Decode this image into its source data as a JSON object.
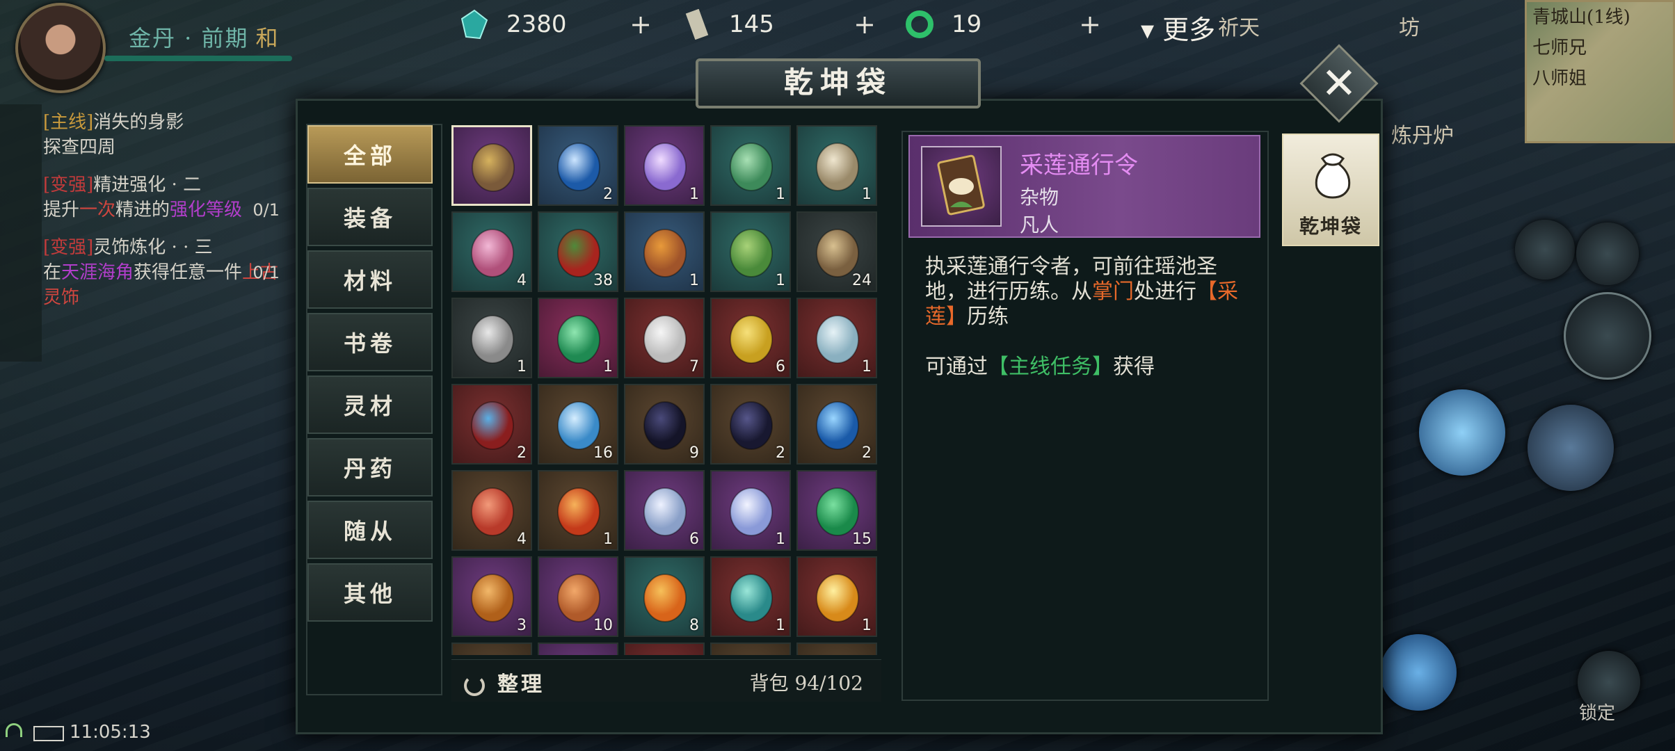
{
  "hud": {
    "realm": "金丹 · 前期",
    "mode": "和",
    "resources": [
      {
        "icon": "jade-gem-icon",
        "value": "2380"
      },
      {
        "icon": "token-ticket-icon",
        "value": "145"
      },
      {
        "icon": "green-jade-ring-icon",
        "value": "19"
      }
    ],
    "more_label": "更多",
    "top_icons": [
      "祈天",
      "坊",
      "炼丹炉"
    ],
    "minimap": {
      "line1": "青城山(1线)",
      "line2": "七师兄",
      "line3": "八师姐"
    }
  },
  "quests": [
    {
      "tag": "[主线]",
      "title": "消失的身影",
      "desc": "探查四周",
      "count": ""
    },
    {
      "tag": "[变强]",
      "title": "精进强化 · 二",
      "desc_pre": "提升",
      "desc_hl1": "一次",
      "desc_mid": "精进的",
      "desc_hl2": "强化等级",
      "count": "0/1"
    },
    {
      "tag": "[变强]",
      "title": "灵饰炼化 · · 三",
      "desc_pre": "在",
      "desc_hl1": "天涯海角",
      "desc_mid": "获得任意一件",
      "desc_hl2": "上古灵饰",
      "count": "0/1"
    }
  ],
  "status": {
    "time": "11:05:13"
  },
  "lock_label": "锁定",
  "window": {
    "title": "乾坤袋",
    "close_label": "✕",
    "categories": [
      "全部",
      "装备",
      "材料",
      "书卷",
      "灵材",
      "丹药",
      "随从",
      "其他"
    ],
    "active_category": "全部",
    "items": [
      {
        "q": "purple",
        "icon": "lotus-token-icon",
        "n": "",
        "c1": "#7a5a3a",
        "c2": "#d6b25e",
        "selected": true
      },
      {
        "q": "blue",
        "icon": "water-orb-icon",
        "n": "2",
        "c1": "#1c5aa8",
        "c2": "#cde6ff"
      },
      {
        "q": "purple",
        "icon": "crystal-shards-icon",
        "n": "1",
        "c1": "#8a6ad0",
        "c2": "#f0dcff"
      },
      {
        "q": "teal",
        "icon": "jade-buddha-icon",
        "n": "1",
        "c1": "#3d8a5a",
        "c2": "#a8e0b4"
      },
      {
        "q": "teal",
        "icon": "scroll-painting-icon",
        "n": "1",
        "c1": "#9a8a6a",
        "c2": "#efe6cf"
      },
      {
        "q": "teal",
        "icon": "pink-pearl-icon",
        "n": "4",
        "c1": "#b0507a",
        "c2": "#f2b8d6"
      },
      {
        "q": "teal",
        "icon": "red-berries-icon",
        "n": "38",
        "c1": "#a8241e",
        "c2": "#4f8a3a"
      },
      {
        "q": "blue",
        "icon": "fruit-basket-icon",
        "n": "1",
        "c1": "#a0542a",
        "c2": "#e89a3a"
      },
      {
        "q": "teal",
        "icon": "herb-basket-icon",
        "n": "1",
        "c1": "#4a8a3a",
        "c2": "#a8d278"
      },
      {
        "q": "gray",
        "icon": "fishing-rod-icon",
        "n": "24",
        "c1": "#7a6040",
        "c2": "#d8c090"
      },
      {
        "q": "gray",
        "icon": "hairpin-icon",
        "n": "1",
        "c1": "#8a8a8a",
        "c2": "#e8e8e8"
      },
      {
        "q": "pink",
        "icon": "jade-stone-icon",
        "n": "1",
        "c1": "#1f8a52",
        "c2": "#8fe6b0"
      },
      {
        "q": "red",
        "icon": "white-vase-icon",
        "n": "7",
        "c1": "#bcbcbc",
        "c2": "#f6f6f6"
      },
      {
        "q": "red",
        "icon": "crescent-moon-icon",
        "n": "6",
        "c1": "#c8a020",
        "c2": "#f6e07a"
      },
      {
        "q": "red",
        "icon": "porcelain-vase-icon",
        "n": "1",
        "c1": "#8ab0c0",
        "c2": "#e6f2f6"
      },
      {
        "q": "red",
        "icon": "spirit-orb-altar-icon",
        "n": "2",
        "c1": "#8a1e1e",
        "c2": "#5ab0e6"
      },
      {
        "q": "brown",
        "icon": "ice-bowl-icon",
        "n": "16",
        "c1": "#3a8ac8",
        "c2": "#d6eeff"
      },
      {
        "q": "brown",
        "icon": "black-stone-icon",
        "n": "9",
        "c1": "#141428",
        "c2": "#4a4a7a"
      },
      {
        "q": "brown",
        "icon": "dark-stone-icon",
        "n": "2",
        "c1": "#181830",
        "c2": "#56568a"
      },
      {
        "q": "brown",
        "icon": "ice-crystal-icon",
        "n": "2",
        "c1": "#1a5aa8",
        "c2": "#9ad6ff"
      },
      {
        "q": "brown",
        "icon": "red-crystal-icon",
        "n": "4",
        "c1": "#b83a2a",
        "c2": "#f29a7a"
      },
      {
        "q": "brown",
        "icon": "fire-crystal-icon",
        "n": "1",
        "c1": "#c43a1a",
        "c2": "#f6b25a"
      },
      {
        "q": "purple",
        "icon": "moonstone-icon",
        "n": "6",
        "c1": "#8aa0c8",
        "c2": "#eef2ff"
      },
      {
        "q": "purple",
        "icon": "opal-icon",
        "n": "1",
        "c1": "#8a9ad8",
        "c2": "#f2f4ff"
      },
      {
        "q": "purple",
        "icon": "emerald-egg-icon",
        "n": "15",
        "c1": "#1a8a4a",
        "c2": "#7ae0a0"
      },
      {
        "q": "purple",
        "icon": "amber-stone-icon",
        "n": "3",
        "c1": "#b0601a",
        "c2": "#f2b86a"
      },
      {
        "q": "purple",
        "icon": "copper-egg-icon",
        "n": "10",
        "c1": "#b05a2a",
        "c2": "#f2a86a"
      },
      {
        "q": "teal",
        "icon": "amber-crystal-icon",
        "n": "8",
        "c1": "#d8641a",
        "c2": "#f6c05a"
      },
      {
        "q": "red",
        "icon": "jade-crystal-cluster-icon",
        "n": "1",
        "c1": "#2a8a8a",
        "c2": "#9ae6d8"
      },
      {
        "q": "red",
        "icon": "golden-sphere-icon",
        "n": "1",
        "c1": "#d88a1a",
        "c2": "#fff0a0"
      },
      {
        "q": "brown",
        "icon": "partial-item-icon",
        "n": "",
        "c1": "#b0601a",
        "c2": "#f2b86a"
      },
      {
        "q": "purple",
        "icon": "partial-item-icon",
        "n": "",
        "c1": "#5a8ad8",
        "c2": "#c8e0ff"
      },
      {
        "q": "red",
        "icon": "partial-item-icon",
        "n": "",
        "c1": "#c83a1a",
        "c2": "#f6a05a"
      },
      {
        "q": "brown",
        "icon": "partial-item-icon",
        "n": "",
        "c1": "#8a6a3a",
        "c2": "#e0c090"
      },
      {
        "q": "brown",
        "icon": "partial-item-icon",
        "n": "",
        "c1": "#8a6a3a",
        "c2": "#e0c090"
      }
    ],
    "sort_label": "整理",
    "capacity": "背包 94/102",
    "detail": {
      "name": "采莲通行令",
      "type": "杂物",
      "rank": "凡人",
      "desc_1": "执采莲通行令者，可前往瑶池圣地，进行历练。从",
      "desc_hl1": "掌门",
      "desc_2": "处进行",
      "desc_hl2": "【采莲】",
      "desc_3": "历练",
      "src_pre": "可通过",
      "src_hl": "【主线任务】",
      "src_post": "获得"
    },
    "side_tab": "乾坤袋"
  },
  "colors": {
    "accent_gold": "#b89a58",
    "purple_name": "#e48cf2",
    "orange": "#e8692a",
    "green": "#3fbf66"
  }
}
